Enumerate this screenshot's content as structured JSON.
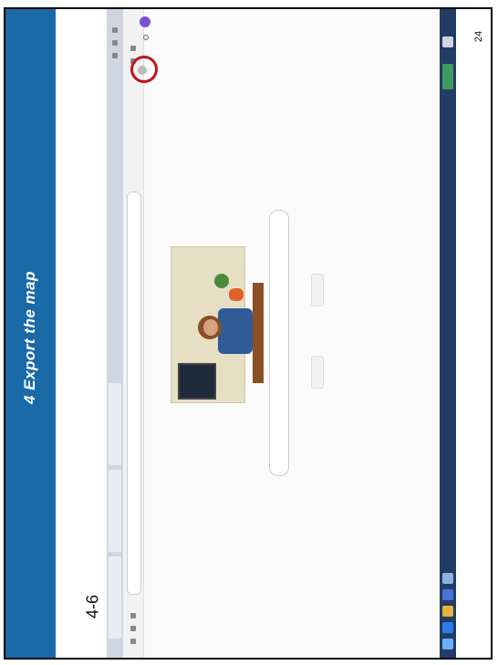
{
  "slide": {
    "title": "4 Export the map",
    "section": "4-6",
    "page_number": "24"
  },
  "colors": {
    "title_band": "#1a6aa8",
    "highlight_circle": "#c0141e",
    "avatar": "#7b4fd1",
    "taskbar": "#233c63"
  },
  "screenshot": {
    "browser_icons": [
      "avatar-icon",
      "apps-grid-icon",
      "settings-icon"
    ],
    "taskbar_icons": [
      "start-icon",
      "edge-icon",
      "explorer-icon",
      "store-icon",
      "mail-icon"
    ]
  }
}
